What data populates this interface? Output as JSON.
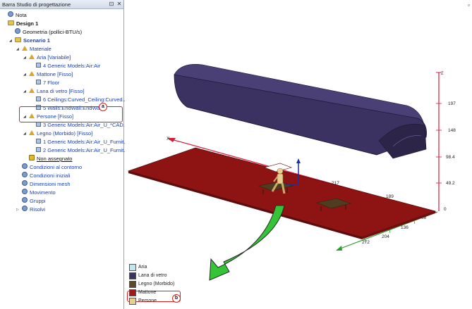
{
  "panel": {
    "title": "Barra Studio di progettazione",
    "pin_icon": "pin-icon",
    "close_icon": "close-icon"
  },
  "tree": [
    {
      "label": "Nota",
      "indent": 0,
      "style": "dark",
      "icon": "note-icon"
    },
    {
      "label": "Design 1",
      "indent": 0,
      "style": "bold",
      "icon": "design-icon"
    },
    {
      "label": "Geometria (pollici-BTU/s)",
      "indent": 1,
      "style": "dark",
      "icon": "geometry-icon"
    },
    {
      "label": "Scenario 1",
      "indent": 1,
      "style": "bold-blue",
      "icon": "scenario-icon",
      "expanded": true
    },
    {
      "label": "Materiale",
      "indent": 2,
      "style": "blue",
      "icon": "material-icon",
      "expanded": true
    },
    {
      "label": "Aria [Variabile]",
      "indent": 3,
      "style": "blue",
      "icon": "material-group-icon",
      "expanded": true
    },
    {
      "label": "4 Generic Models:Air:Air",
      "indent": 4,
      "style": "blue",
      "icon": "part-icon"
    },
    {
      "label": "Mattone [Fisso]",
      "indent": 3,
      "style": "blue",
      "icon": "material-group-icon",
      "expanded": true
    },
    {
      "label": "7 Floor",
      "indent": 4,
      "style": "blue",
      "icon": "part-icon"
    },
    {
      "label": "Lana di vetro [Fisso]",
      "indent": 3,
      "style": "blue",
      "icon": "material-group-icon",
      "expanded": true
    },
    {
      "label": "6 Ceilings:Curved_Ceiling:Curved...",
      "indent": 4,
      "style": "blue",
      "icon": "part-icon"
    },
    {
      "label": "5 Walls:EndWall:EndWall",
      "indent": 4,
      "style": "blue",
      "icon": "part-icon"
    },
    {
      "label": "Persone [Fisso]",
      "indent": 3,
      "style": "blue",
      "icon": "material-group-icon",
      "expanded": true
    },
    {
      "label": "3 Generic Models:Air:Air_U_*CAD...",
      "indent": 4,
      "style": "blue",
      "icon": "part-icon"
    },
    {
      "label": "Legno (Morbido) [Fisso]",
      "indent": 3,
      "style": "blue",
      "icon": "material-group-icon",
      "expanded": true
    },
    {
      "label": "1 Generic Models:Air:Air_U_Furnit...",
      "indent": 4,
      "style": "blue",
      "icon": "part-icon"
    },
    {
      "label": "2 Generic Models:Air:Air_U_Furnit...",
      "indent": 4,
      "style": "blue",
      "icon": "part-icon"
    },
    {
      "label": "Non assegnato",
      "indent": 3,
      "style": "underline",
      "icon": "warning-icon"
    },
    {
      "label": "Condizioni al contorno",
      "indent": 2,
      "style": "blue",
      "icon": "boundary-icon"
    },
    {
      "label": "Condizioni iniziali",
      "indent": 2,
      "style": "blue",
      "icon": "initial-icon"
    },
    {
      "label": "Dimensioni mesh",
      "indent": 2,
      "style": "blue",
      "icon": "mesh-icon"
    },
    {
      "label": "Movimento",
      "indent": 2,
      "style": "blue",
      "icon": "motion-icon"
    },
    {
      "label": "Gruppi",
      "indent": 2,
      "style": "blue",
      "icon": "groups-icon"
    },
    {
      "label": "Risolvi",
      "indent": 2,
      "style": "blue",
      "icon": "solve-icon",
      "collapsed": true
    }
  ],
  "callouts": {
    "a": "a",
    "b": "b"
  },
  "axes": {
    "x_label": "X",
    "z_label": "Z",
    "z_ticks": [
      "197",
      "148",
      "98.4",
      "49.2",
      "0"
    ],
    "x_ticks": [
      "217",
      "189"
    ],
    "y_ticks": [
      "68",
      "136",
      "204",
      "272"
    ]
  },
  "legend": [
    {
      "label": "Aria",
      "color": "#bfe8ee"
    },
    {
      "label": "Lana di vetro",
      "color": "#3d3360"
    },
    {
      "label": "Legno (Morbido)",
      "color": "#5a4a2a"
    },
    {
      "label": "Mattone",
      "color": "#a01818"
    },
    {
      "label": "Persone",
      "color": "#e7cf93"
    }
  ],
  "colors": {
    "floor": "#8e1414",
    "roof": "#3b3262",
    "arrow": "#35c435",
    "axis_red": "#d81a3a",
    "axis_green": "#2aa02a"
  }
}
